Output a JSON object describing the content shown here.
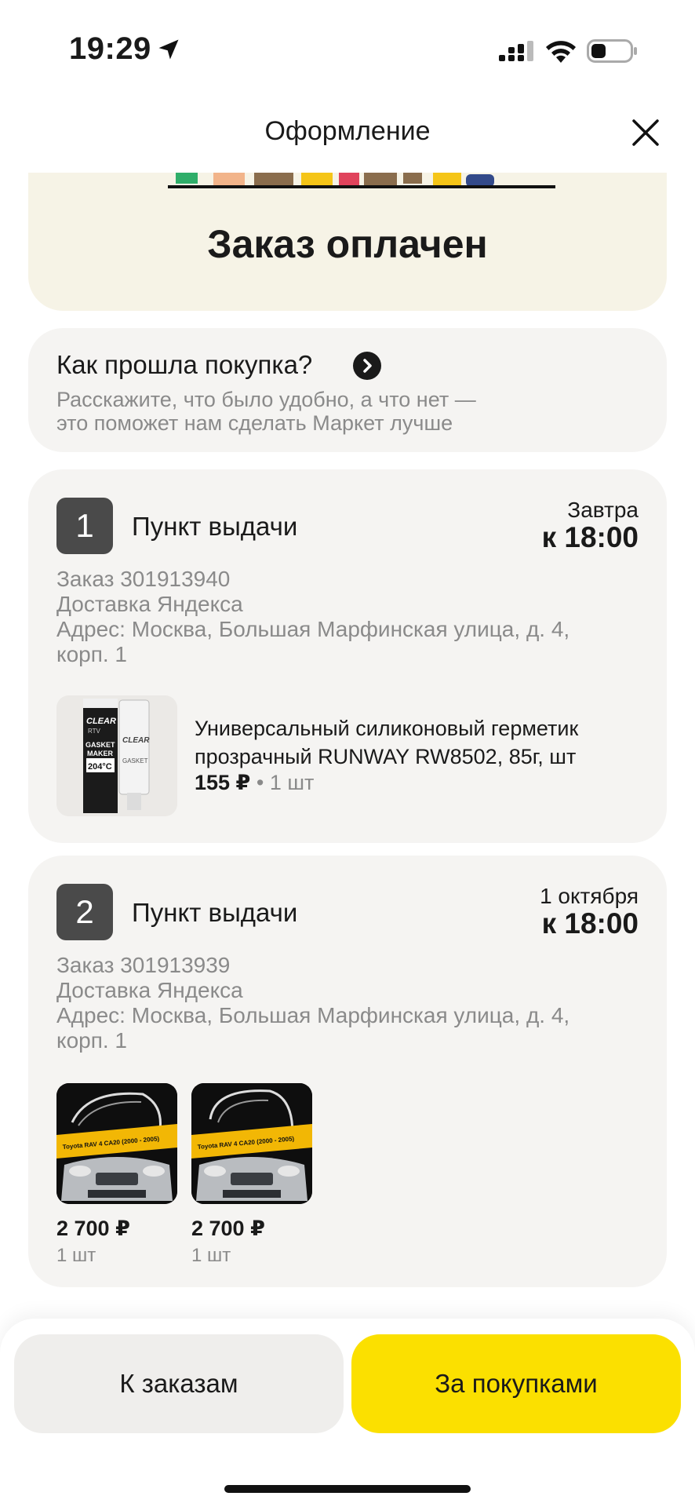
{
  "status_bar": {
    "time": "19:29"
  },
  "header": {
    "title": "Оформление"
  },
  "banner": {
    "title": "Заказ оплачен"
  },
  "feedback": {
    "title": "Как прошла покупка?",
    "subtitle_line1": "Расскажите, что было удобно, а что нет —",
    "subtitle_line2": "это поможет нам сделать Маркет лучше"
  },
  "orders": [
    {
      "number": "1",
      "type": "Пункт выдачи",
      "date": "Завтра",
      "time": "к 18:00",
      "order_id": "Заказ 301913940",
      "delivery": "Доставка Яндекса",
      "address_line1": "Адрес: Москва, Большая Марфинская улица, д. 4,",
      "address_line2": "корп. 1",
      "product": {
        "name": "Универсальный силиконовый герметик прозрачный RUNWAY RW8502,  85г, шт",
        "price": "155 ₽",
        "qty": "• 1 шт",
        "image_text": {
          "clear": "CLEAR",
          "rtv": "RTV",
          "gasket": "GASKET",
          "maker": "MAKER",
          "temp": "204°C"
        }
      }
    },
    {
      "number": "2",
      "type": "Пункт выдачи",
      "date": "1 октября",
      "time": "к 18:00",
      "order_id": "Заказ 301913939",
      "delivery": "Доставка Яндекса",
      "address_line1": "Адрес: Москва, Большая Марфинская улица, д. 4,",
      "address_line2": "корп. 1",
      "items": [
        {
          "price": "2 700 ₽",
          "qty": "1 шт",
          "image_caption": "Toyota RAV 4 CA20 (2000 - 2005)"
        },
        {
          "price": "2 700 ₽",
          "qty": "1 шт",
          "image_caption": "Toyota RAV 4 CA20 (2000 - 2005)"
        }
      ]
    }
  ],
  "buttons": {
    "orders": "К заказам",
    "shop": "За покупками"
  },
  "colors": {
    "accent_yellow": "#fbe000",
    "banner_bg": "#f6f3e6",
    "card_bg": "#f5f4f2"
  }
}
